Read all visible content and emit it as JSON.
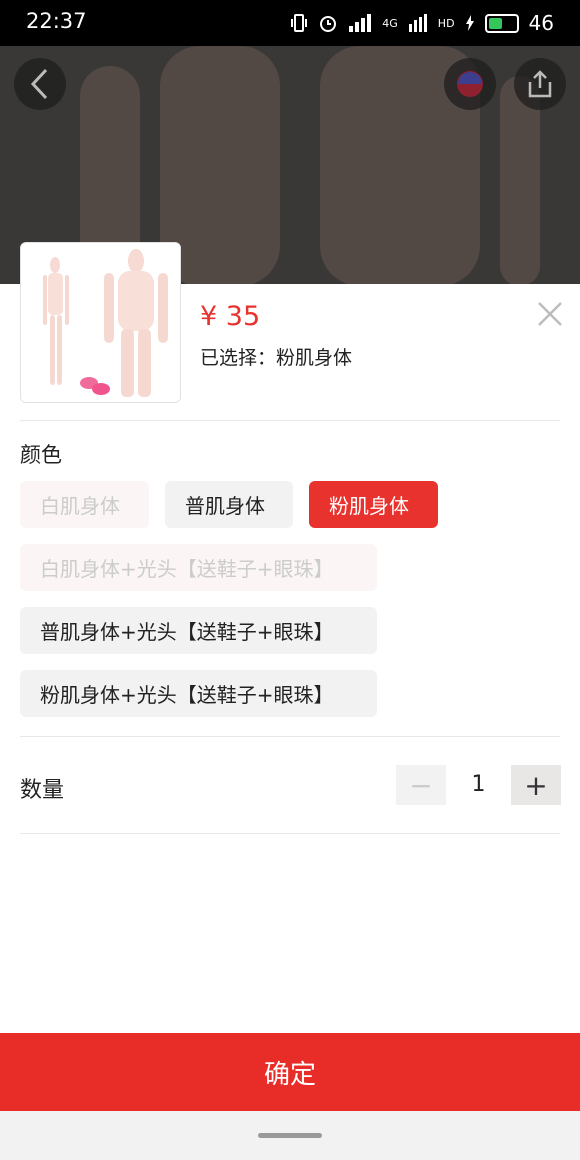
{
  "status_bar": {
    "time": "22:37",
    "battery": "46",
    "signal_label": "4G",
    "hd_label": "HD"
  },
  "product": {
    "price": "¥ 35",
    "selected_prefix": "已选择：",
    "selected_value": "粉肌身体"
  },
  "color_section": {
    "label": "颜色",
    "options": [
      {
        "label": "白肌身体",
        "state": "disabled"
      },
      {
        "label": "普肌身体",
        "state": "normal"
      },
      {
        "label": "粉肌身体",
        "state": "selected"
      },
      {
        "label": "白肌身体+光头【送鞋子+眼珠】",
        "state": "disabled"
      },
      {
        "label": "普肌身体+光头【送鞋子+眼珠】",
        "state": "normal"
      },
      {
        "label": "粉肌身体+光头【送鞋子+眼珠】",
        "state": "normal"
      }
    ]
  },
  "quantity": {
    "label": "数量",
    "value": "1",
    "minus": "−",
    "plus": "+"
  },
  "confirm_button": {
    "label": "确定"
  },
  "colors": {
    "accent": "#e8322e",
    "button": "#e82c28"
  }
}
